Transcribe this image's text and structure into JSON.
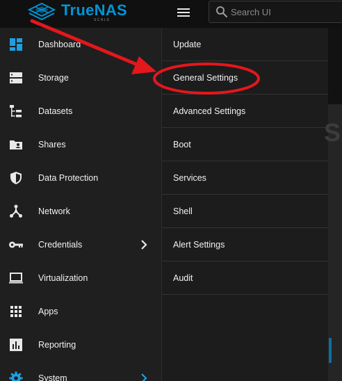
{
  "app": {
    "brand_name": "TrueNAS",
    "brand_edition": "SCALE",
    "brand_color": "#0095d5"
  },
  "header": {
    "search_placeholder": "Search UI",
    "menu_icon": "hamburger-menu-icon"
  },
  "sidebar": {
    "items": [
      {
        "label": "Dashboard",
        "icon": "dashboard-icon"
      },
      {
        "label": "Storage",
        "icon": "storage-icon"
      },
      {
        "label": "Datasets",
        "icon": "datasets-icon"
      },
      {
        "label": "Shares",
        "icon": "shares-folder-icon"
      },
      {
        "label": "Data Protection",
        "icon": "shield-icon"
      },
      {
        "label": "Network",
        "icon": "network-icon"
      },
      {
        "label": "Credentials",
        "icon": "key-icon"
      },
      {
        "label": "Virtualization",
        "icon": "laptop-icon"
      },
      {
        "label": "Apps",
        "icon": "apps-grid-icon"
      },
      {
        "label": "Reporting",
        "icon": "reporting-chart-icon"
      },
      {
        "label": "System",
        "icon": "system-gear-icon"
      }
    ]
  },
  "submenu": {
    "items": [
      {
        "label": "Update"
      },
      {
        "label": "General Settings"
      },
      {
        "label": "Advanced Settings"
      },
      {
        "label": "Boot"
      },
      {
        "label": "Services"
      },
      {
        "label": "Shell"
      },
      {
        "label": "Alert Settings"
      },
      {
        "label": "Audit"
      }
    ]
  },
  "annotation": {
    "color": "#e3171c",
    "target": "General Settings"
  }
}
